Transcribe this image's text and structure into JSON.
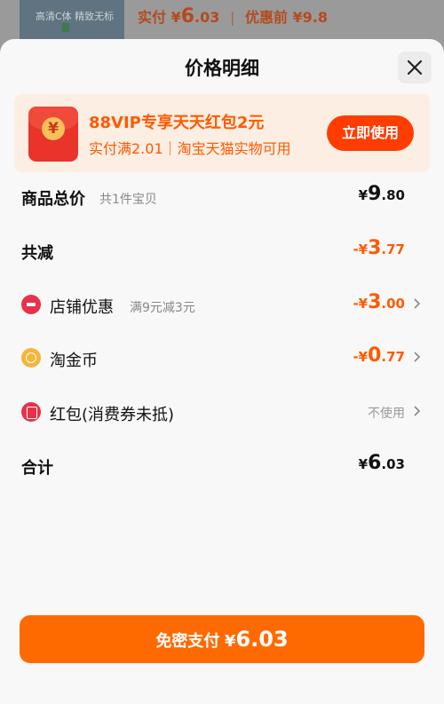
{
  "background": {
    "thumb_text": "高清C体 精致无标",
    "price_paid_label": "实付",
    "price_paid_symbol": "¥",
    "price_paid_int": "6",
    "price_paid_dec": ".03",
    "price_before": "优惠前 ¥9.8"
  },
  "sheet": {
    "title": "价格明细",
    "close_icon": "close-icon"
  },
  "promo": {
    "title": "88VIP专享天天红包2元",
    "subtitle": "实付满2.01｜淘宝天猫实物可用",
    "button": "立即使用",
    "icon": "red-packet-icon"
  },
  "rows": {
    "total": {
      "label": "商品总价",
      "note": "共1件宝贝",
      "sym": "¥",
      "int": "9",
      "dec": ".80"
    },
    "reduce": {
      "label": "共减",
      "sym": "-¥",
      "int": "3",
      "dec": ".77"
    },
    "shop": {
      "label": "店铺优惠",
      "note": "满9元减3元",
      "sym": "-¥",
      "int": "3",
      "dec": ".00"
    },
    "coin": {
      "label": "淘金币",
      "sym": "-¥",
      "int": "0",
      "dec": ".77"
    },
    "packet": {
      "label": "红包(消费券未抵)",
      "value": "不使用"
    },
    "sum": {
      "label": "合计",
      "sym": "¥",
      "int": "6",
      "dec": ".03"
    }
  },
  "pay": {
    "label": "免密支付",
    "sym": "¥",
    "amount": "6.03"
  },
  "colors": {
    "accent": "#ff6a00",
    "discount": "#ff5a00",
    "promo_bg": "#fdeee4",
    "red": "#e8324a"
  }
}
